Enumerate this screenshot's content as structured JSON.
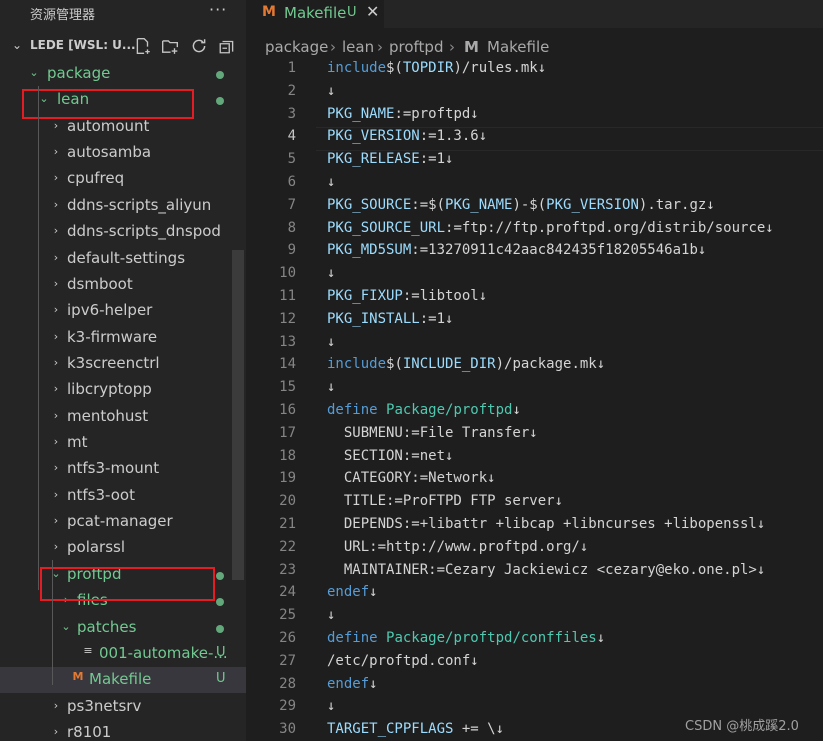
{
  "explorer": {
    "title": "资源管理器",
    "more": "···",
    "workspace": "LEDE [WSL: U...",
    "items": [
      {
        "label": "package",
        "chev": "⌄",
        "git": true,
        "dot": true
      },
      {
        "label": "lean",
        "chev": "⌄",
        "git": true,
        "dot": true
      },
      {
        "label": "automount",
        "chev": "›"
      },
      {
        "label": "autosamba",
        "chev": "›"
      },
      {
        "label": "cpufreq",
        "chev": "›"
      },
      {
        "label": "ddns-scripts_aliyun",
        "chev": "›"
      },
      {
        "label": "ddns-scripts_dnspod",
        "chev": "›"
      },
      {
        "label": "default-settings",
        "chev": "›"
      },
      {
        "label": "dsmboot",
        "chev": "›"
      },
      {
        "label": "ipv6-helper",
        "chev": "›"
      },
      {
        "label": "k3-firmware",
        "chev": "›"
      },
      {
        "label": "k3screenctrl",
        "chev": "›"
      },
      {
        "label": "libcryptopp",
        "chev": "›"
      },
      {
        "label": "mentohust",
        "chev": "›"
      },
      {
        "label": "mt",
        "chev": "›"
      },
      {
        "label": "ntfs3-mount",
        "chev": "›"
      },
      {
        "label": "ntfs3-oot",
        "chev": "›"
      },
      {
        "label": "pcat-manager",
        "chev": "›"
      },
      {
        "label": "polarssl",
        "chev": "›"
      },
      {
        "label": "proftpd",
        "chev": "⌄",
        "git": true,
        "dot": true
      },
      {
        "label": "files",
        "chev": "›",
        "git": true,
        "dot": true
      },
      {
        "label": "patches",
        "chev": "⌄",
        "git": true,
        "dot": true
      },
      {
        "label": "001-automake-...",
        "badge": "U",
        "git": true
      },
      {
        "label": "Makefile",
        "badge": "U",
        "git": true,
        "selected": true
      },
      {
        "label": "ps3netsrv",
        "chev": "›"
      },
      {
        "label": "r8101",
        "chev": "›"
      }
    ]
  },
  "tab": {
    "icon": "M",
    "name": "Makefile",
    "badge": "U",
    "close": "✕"
  },
  "breadcrumb": [
    "package",
    "lean",
    "proftpd",
    "Makefile"
  ],
  "editor": {
    "current_line": 4,
    "lines": [
      [
        [
          "kw",
          "include"
        ],
        [
          "",
          "$("
        ],
        [
          "vr",
          "TOPDIR"
        ],
        [
          "",
          ")/rules.mk↓"
        ]
      ],
      [
        [
          "",
          "↓"
        ]
      ],
      [
        [
          "vr",
          "PKG_NAME"
        ],
        [
          "",
          ":=proftpd↓"
        ]
      ],
      [
        [
          "vr",
          "PKG_VERSION"
        ],
        [
          "",
          ":=1.3.6↓"
        ]
      ],
      [
        [
          "vr",
          "PKG_RELEASE"
        ],
        [
          "",
          ":=1↓"
        ]
      ],
      [
        [
          "",
          "↓"
        ]
      ],
      [
        [
          "vr",
          "PKG_SOURCE"
        ],
        [
          "",
          ":=$("
        ],
        [
          "vr",
          "PKG_NAME"
        ],
        [
          "",
          ")-$("
        ],
        [
          "vr",
          "PKG_VERSION"
        ],
        [
          "",
          ").tar.gz↓"
        ]
      ],
      [
        [
          "vr",
          "PKG_SOURCE_URL"
        ],
        [
          "",
          ":=ftp://ftp.proftpd.org/distrib/source↓"
        ]
      ],
      [
        [
          "vr",
          "PKG_MD5SUM"
        ],
        [
          "",
          ":=13270911c42aac842435f18205546a1b↓"
        ]
      ],
      [
        [
          "",
          "↓"
        ]
      ],
      [
        [
          "vr",
          "PKG_FIXUP"
        ],
        [
          "",
          ":=libtool↓"
        ]
      ],
      [
        [
          "vr",
          "PKG_INSTALL"
        ],
        [
          "",
          ":=1↓"
        ]
      ],
      [
        [
          "",
          "↓"
        ]
      ],
      [
        [
          "kw",
          "include"
        ],
        [
          "",
          "$("
        ],
        [
          "vr",
          "INCLUDE_DIR"
        ],
        [
          "",
          ")/package.mk↓"
        ]
      ],
      [
        [
          "",
          "↓"
        ]
      ],
      [
        [
          "kw",
          "define"
        ],
        [
          "",
          " "
        ],
        [
          "fn",
          "Package/proftpd"
        ],
        [
          "",
          "↓"
        ]
      ],
      [
        [
          "",
          "  SUBMENU:=File Transfer↓"
        ]
      ],
      [
        [
          "",
          "  SECTION:=net↓"
        ]
      ],
      [
        [
          "",
          "  CATEGORY:=Network↓"
        ]
      ],
      [
        [
          "",
          "  TITLE:=ProFTPD FTP server↓"
        ]
      ],
      [
        [
          "",
          "  DEPENDS:=+libattr +libcap +libncurses +libopenssl↓"
        ]
      ],
      [
        [
          "",
          "  URL:=http://www.proftpd.org/↓"
        ]
      ],
      [
        [
          "",
          "  MAINTAINER:=Cezary Jackiewicz <cezary@eko.one.pl>↓"
        ]
      ],
      [
        [
          "kw",
          "endef"
        ],
        [
          "",
          "↓"
        ]
      ],
      [
        [
          "",
          "↓"
        ]
      ],
      [
        [
          "kw",
          "define"
        ],
        [
          "",
          " "
        ],
        [
          "fn",
          "Package/proftpd/conffiles"
        ],
        [
          "",
          "↓"
        ]
      ],
      [
        [
          "",
          "/etc/proftpd.conf↓"
        ]
      ],
      [
        [
          "kw",
          "endef"
        ],
        [
          "",
          "↓"
        ]
      ],
      [
        [
          "",
          "↓"
        ]
      ],
      [
        [
          "vr",
          "TARGET_CPPFLAGS"
        ],
        [
          "",
          " += \\↓"
        ]
      ]
    ]
  },
  "watermark": "CSDN @桃成蹊2.0",
  "colors": {
    "git_untracked": "#73c991",
    "annotation_box": "#e51c23",
    "makefile_icon": "#e37933"
  }
}
